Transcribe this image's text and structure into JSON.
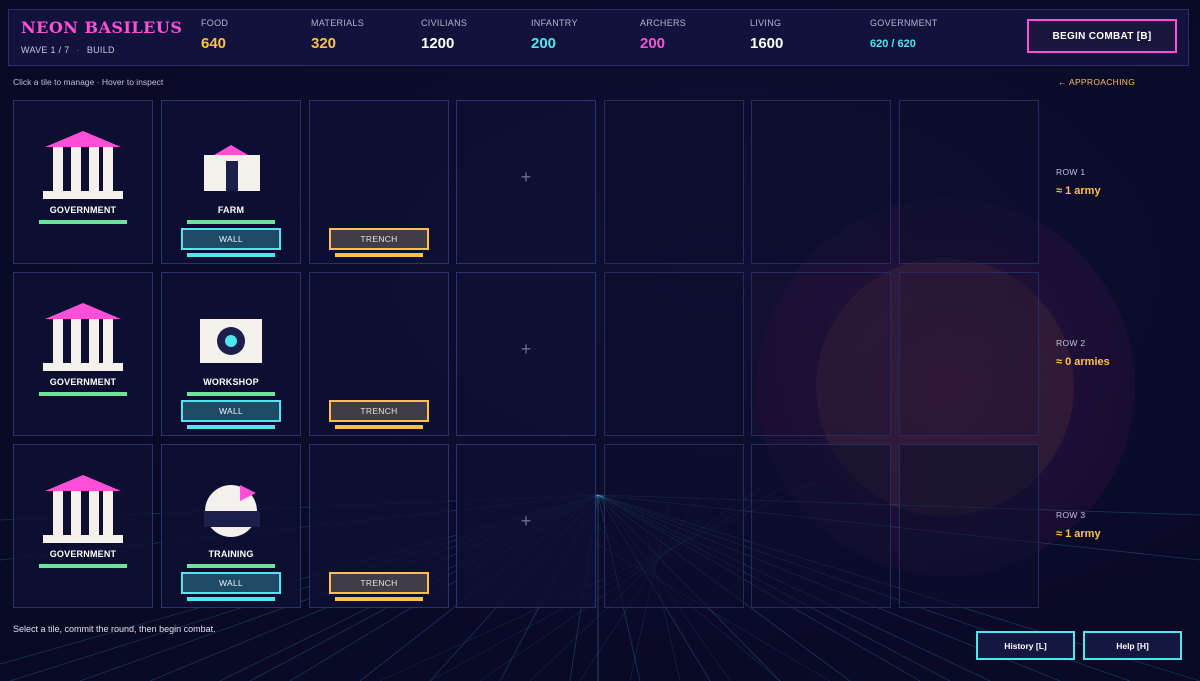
{
  "header": {
    "title": "NEON BASILEUS",
    "wave": "WAVE 1 / 7",
    "phase": "BUILD",
    "combat_button": "BEGIN COMBAT  [B]"
  },
  "stats": [
    {
      "label": "FOOD",
      "value": "640",
      "color": "#ffc04a"
    },
    {
      "label": "MATERIALS",
      "value": "320",
      "color": "#ffc04a"
    },
    {
      "label": "CIVILIANS",
      "value": "1200",
      "color": "#ffffff"
    },
    {
      "label": "INFANTRY",
      "value": "200",
      "color": "#4fe6f0"
    },
    {
      "label": "ARCHERS",
      "value": "200",
      "color": "#ff4fd8"
    },
    {
      "label": "LIVING",
      "value": "1600",
      "color": "#ffffff"
    },
    {
      "label": "GOVERNMENT",
      "value": "620 / 620",
      "color": "#4fe6f0"
    }
  ],
  "hint": "Click a tile to manage · Hover to inspect",
  "approaching": "← APPROACHING",
  "rows": [
    {
      "government": "GOVERNMENT",
      "building": "FARM",
      "building_icon": "farm-icon",
      "wall": "WALL",
      "trench": "TRENCH",
      "plus": "+",
      "row_label": "ROW 1",
      "army": "≈ 1 army"
    },
    {
      "government": "GOVERNMENT",
      "building": "WORKSHOP",
      "building_icon": "workshop-icon",
      "wall": "WALL",
      "trench": "TRENCH",
      "plus": "+",
      "row_label": "ROW 2",
      "army": "≈ 0 armies"
    },
    {
      "government": "GOVERNMENT",
      "building": "TRAINING",
      "building_icon": "training-icon",
      "wall": "WALL",
      "trench": "TRENCH",
      "plus": "+",
      "row_label": "ROW 3",
      "army": "≈ 1 army"
    }
  ],
  "colors": {
    "accent_pink": "#ff4fd8",
    "accent_cyan": "#4fe6f0",
    "accent_gold": "#ffc04a",
    "health_green": "#6fe39a"
  },
  "footer": {
    "hint": "Select a tile, commit the round, then begin combat.",
    "history_button": "History [L]",
    "help_button": "Help [H]"
  }
}
